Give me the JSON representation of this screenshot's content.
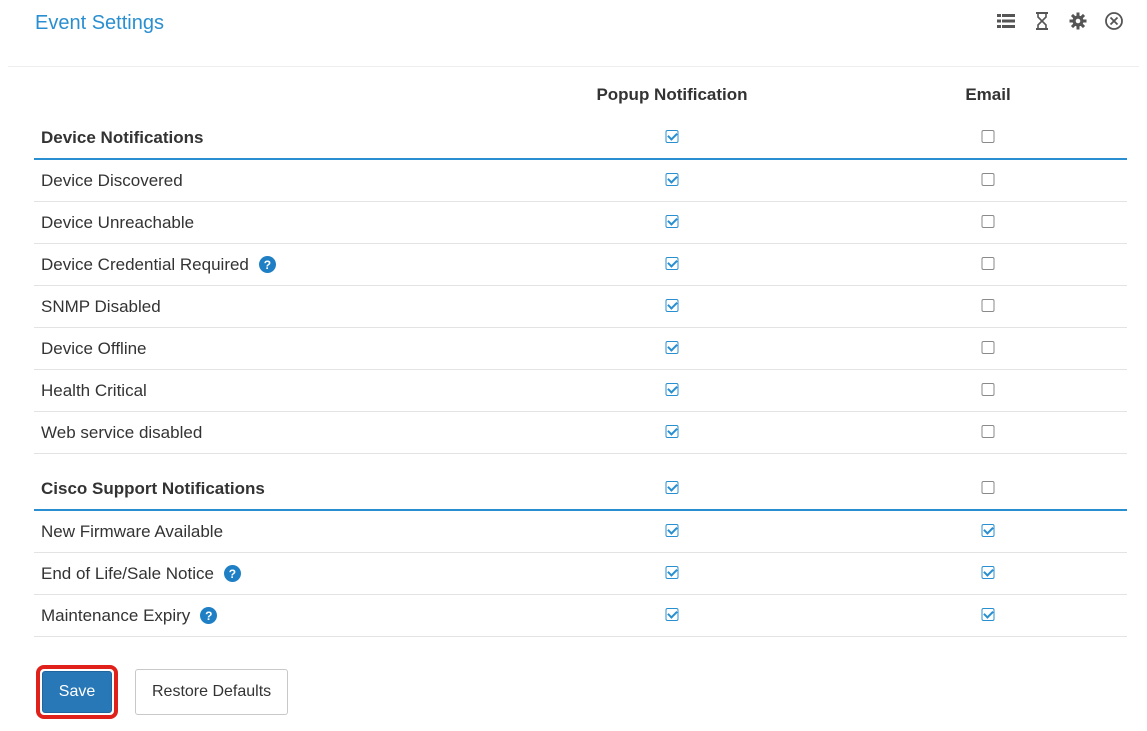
{
  "header": {
    "title": "Event Settings",
    "icons": [
      "list-icon",
      "hourglass-icon",
      "gear-icon",
      "close-circle-icon"
    ]
  },
  "columns": {
    "popup": "Popup Notification",
    "email": "Email"
  },
  "sections": [
    {
      "name": "Device Notifications",
      "popup": true,
      "email": false,
      "rows": [
        {
          "label": "Device Discovered",
          "popup": true,
          "email": false,
          "help": false
        },
        {
          "label": "Device Unreachable",
          "popup": true,
          "email": false,
          "help": false
        },
        {
          "label": "Device Credential Required",
          "popup": true,
          "email": false,
          "help": true
        },
        {
          "label": "SNMP Disabled",
          "popup": true,
          "email": false,
          "help": false
        },
        {
          "label": "Device Offline",
          "popup": true,
          "email": false,
          "help": false
        },
        {
          "label": "Health Critical",
          "popup": true,
          "email": false,
          "help": false
        },
        {
          "label": "Web service disabled",
          "popup": true,
          "email": false,
          "help": false
        }
      ]
    },
    {
      "name": "Cisco Support Notifications",
      "popup": true,
      "email": false,
      "rows": [
        {
          "label": "New Firmware Available",
          "popup": true,
          "email": true,
          "help": false
        },
        {
          "label": "End of Life/Sale Notice",
          "popup": true,
          "email": true,
          "help": true
        },
        {
          "label": "Maintenance Expiry",
          "popup": true,
          "email": true,
          "help": true
        }
      ]
    }
  ],
  "help_glyph": "?",
  "buttons": {
    "save": "Save",
    "restore": "Restore Defaults"
  },
  "colors": {
    "accent": "#2a8fd0",
    "primary_button": "#2877b6",
    "highlight": "#e0201b"
  }
}
